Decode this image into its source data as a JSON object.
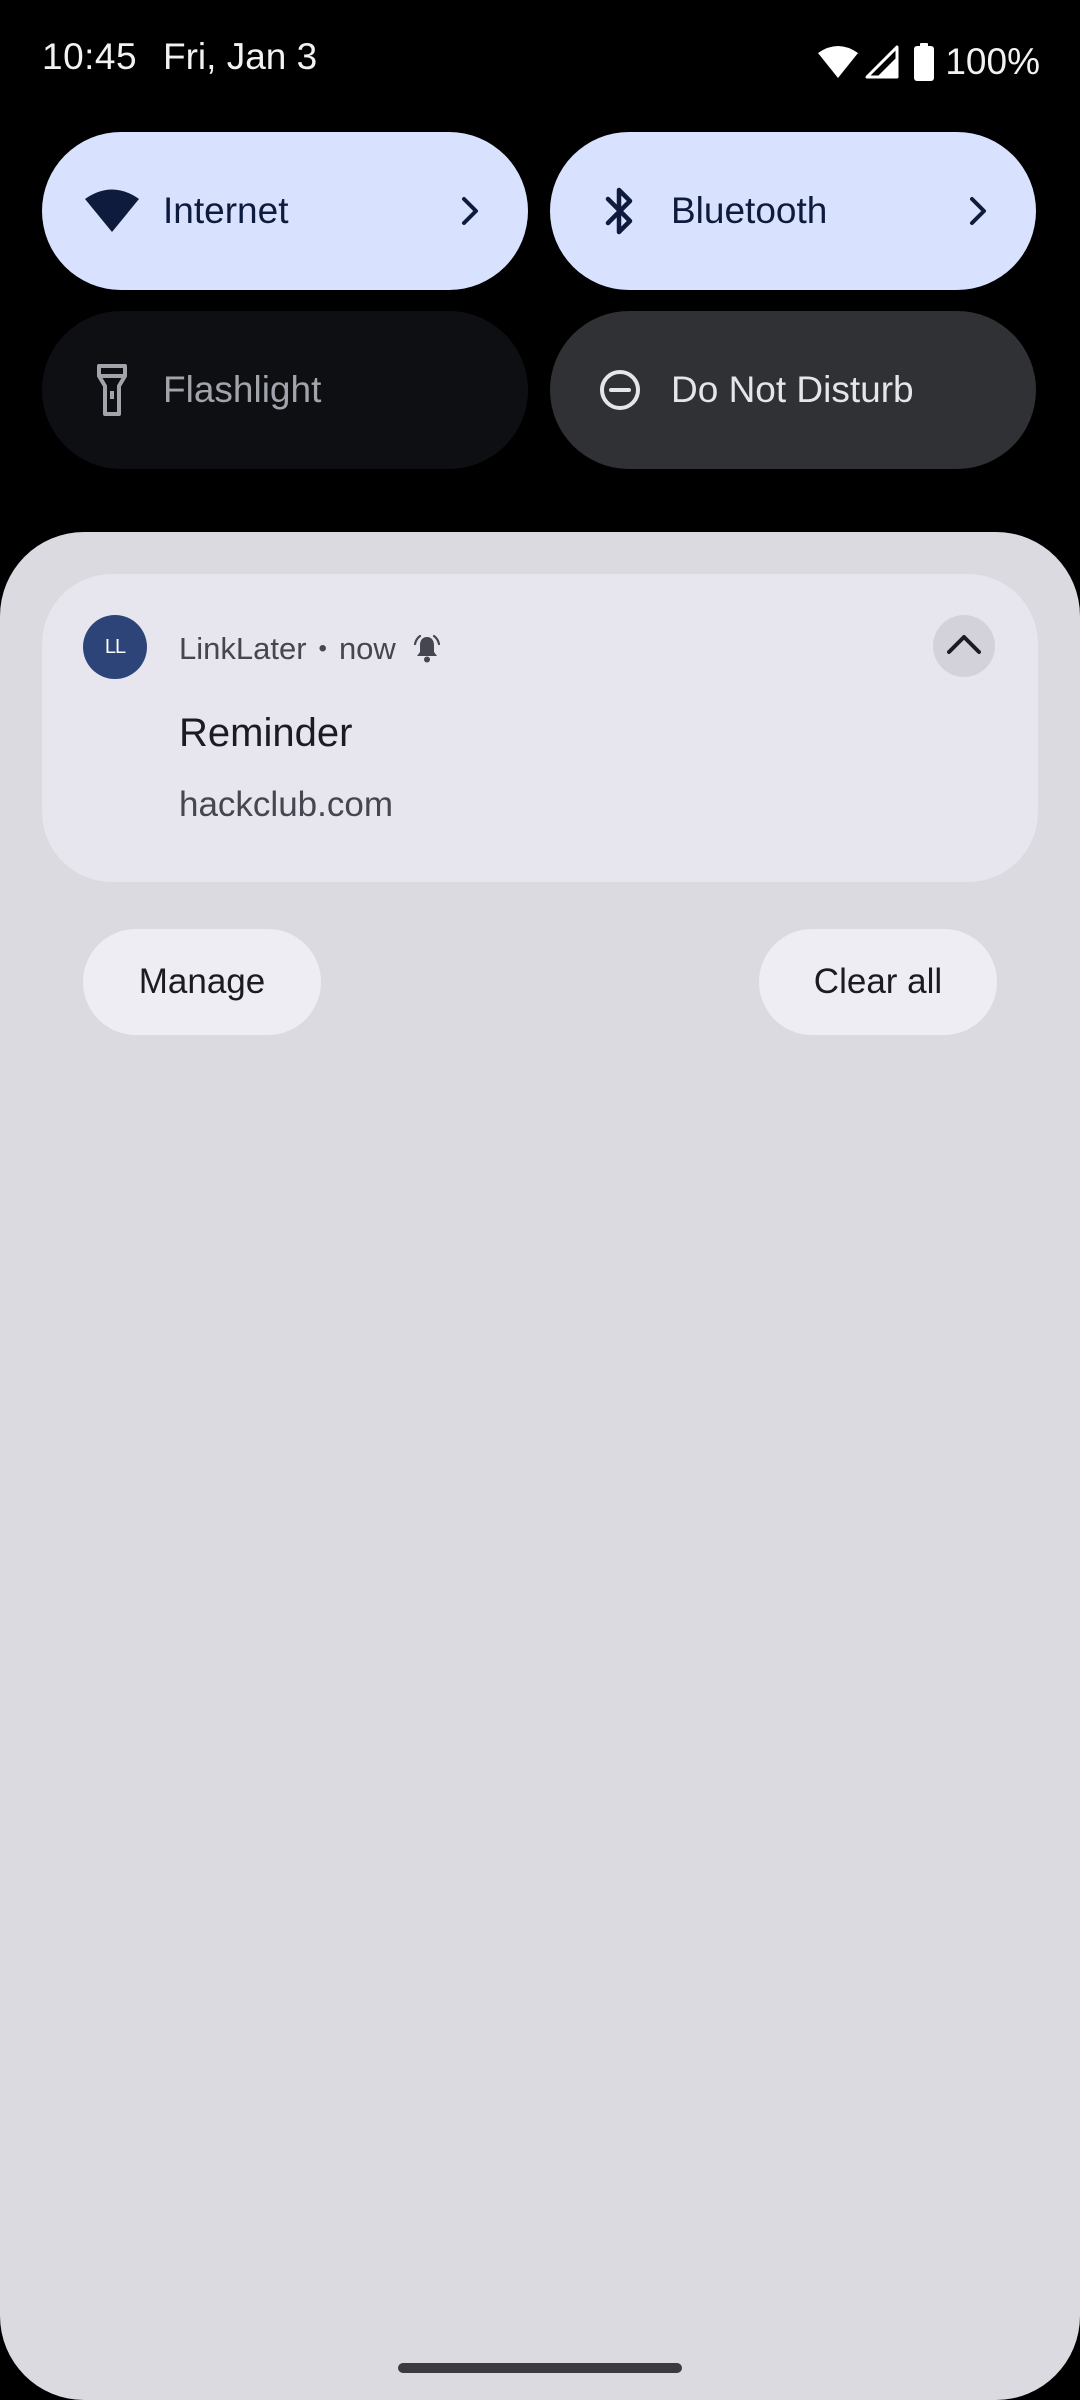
{
  "status_bar": {
    "time": "10:45",
    "date": "Fri, Jan 3",
    "battery": "100%",
    "icons": [
      "wifi-icon",
      "cell-signal-icon",
      "battery-icon"
    ]
  },
  "quick_settings": {
    "tiles": [
      {
        "label": "Internet",
        "icon": "wifi-icon",
        "state": "on",
        "has_chevron": true
      },
      {
        "label": "Bluetooth",
        "icon": "bluetooth-icon",
        "state": "on",
        "has_chevron": true
      },
      {
        "label": "Flashlight",
        "icon": "flashlight-icon",
        "state": "unavailable",
        "has_chevron": false
      },
      {
        "label": "Do Not Disturb",
        "icon": "do-not-disturb-icon",
        "state": "off",
        "has_chevron": false
      }
    ]
  },
  "notification": {
    "app_initials": "LL",
    "app_name": "LinkLater",
    "separator": "•",
    "time": "now",
    "alert_icon": "bell-icon",
    "title": "Reminder",
    "body": "hackclub.com",
    "expand_icon": "chevron-up-icon"
  },
  "shade_actions": {
    "manage_label": "Manage",
    "clear_all_label": "Clear all"
  },
  "colors": {
    "tile_on": "#d8e2ff",
    "tile_off": "#303135",
    "tile_unavailable": "#0e0f13",
    "shade_background": "#dadae0",
    "card_background": "#e7e6ef",
    "app_avatar": "#2c4478"
  }
}
